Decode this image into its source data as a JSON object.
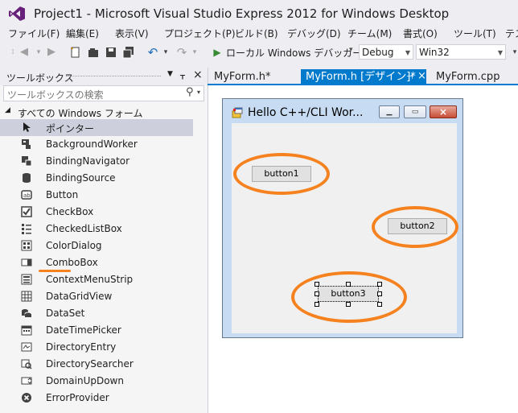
{
  "window": {
    "title": "Project1 - Microsoft Visual Studio Express 2012 for Windows Desktop"
  },
  "menu": [
    "ファイル(F)",
    "編集(E)",
    "表示(V)",
    "プロジェクト(P)",
    "ビルド(B)",
    "デバッグ(D)",
    "チーム(M)",
    "書式(O)",
    "ツール(T)",
    "テス"
  ],
  "toolbar": {
    "run_label": "ローカル Windows デバッガー",
    "config": "Debug",
    "platform": "Win32"
  },
  "toolbox": {
    "title": "ツールボックス",
    "search_placeholder": "ツールボックスの検索",
    "group": "すべての Windows フォーム",
    "items": [
      {
        "label": "ポインター",
        "icon": "pointer-icon"
      },
      {
        "label": "BackgroundWorker",
        "icon": "backgroundworker-icon"
      },
      {
        "label": "BindingNavigator",
        "icon": "bindingnavigator-icon"
      },
      {
        "label": "BindingSource",
        "icon": "bindingsource-icon"
      },
      {
        "label": "Button",
        "icon": "button-icon"
      },
      {
        "label": "CheckBox",
        "icon": "checkbox-icon"
      },
      {
        "label": "CheckedListBox",
        "icon": "checkedlistbox-icon"
      },
      {
        "label": "ColorDialog",
        "icon": "colordialog-icon"
      },
      {
        "label": "ComboBox",
        "icon": "combobox-icon"
      },
      {
        "label": "ContextMenuStrip",
        "icon": "contextmenustrip-icon"
      },
      {
        "label": "DataGridView",
        "icon": "datagridview-icon"
      },
      {
        "label": "DataSet",
        "icon": "dataset-icon"
      },
      {
        "label": "DateTimePicker",
        "icon": "datetimepicker-icon"
      },
      {
        "label": "DirectoryEntry",
        "icon": "directoryentry-icon"
      },
      {
        "label": "DirectorySearcher",
        "icon": "directorysearcher-icon"
      },
      {
        "label": "DomainUpDown",
        "icon": "domainupdown-icon"
      },
      {
        "label": "ErrorProvider",
        "icon": "errorprovider-icon"
      }
    ]
  },
  "tabs": [
    {
      "label": "MyForm.h*"
    },
    {
      "label": "MyForm.h [デザイン]*",
      "active": true
    },
    {
      "label": "MyForm.cpp"
    }
  ],
  "form": {
    "title": "Hello C++/CLI Wor...",
    "buttons": [
      "button1",
      "button2",
      "button3"
    ]
  },
  "colors": {
    "accent": "#007acc",
    "highlight": "#f5821f"
  }
}
